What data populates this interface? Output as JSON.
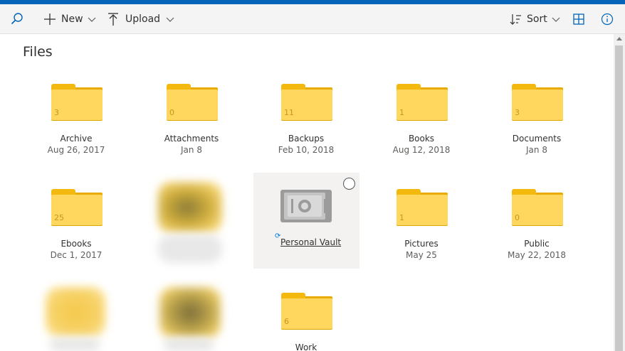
{
  "toolbar": {
    "new_label": "New",
    "upload_label": "Upload",
    "sort_label": "Sort"
  },
  "page": {
    "title": "Files"
  },
  "items": [
    {
      "name": "Archive",
      "date": "Aug 26, 2017",
      "count": "3"
    },
    {
      "name": "Attachments",
      "date": "Jan 8",
      "count": "0"
    },
    {
      "name": "Backups",
      "date": "Feb 10, 2018",
      "count": "11"
    },
    {
      "name": "Books",
      "date": "Aug 12, 2018",
      "count": "1"
    },
    {
      "name": "Documents",
      "date": "Jan 8",
      "count": "3"
    },
    {
      "name": "Ebooks",
      "date": "Dec 1, 2017",
      "count": "25"
    },
    {
      "name": "Personal Vault"
    },
    {
      "name": "Pictures",
      "date": "May 25",
      "count": "1"
    },
    {
      "name": "Public",
      "date": "May 22, 2018",
      "count": "0"
    },
    {
      "name": "Work",
      "count": "6"
    }
  ],
  "colors": {
    "accent": "#0364b8",
    "folder": "#ffd75e",
    "folder_tab": "#f3b90f"
  }
}
